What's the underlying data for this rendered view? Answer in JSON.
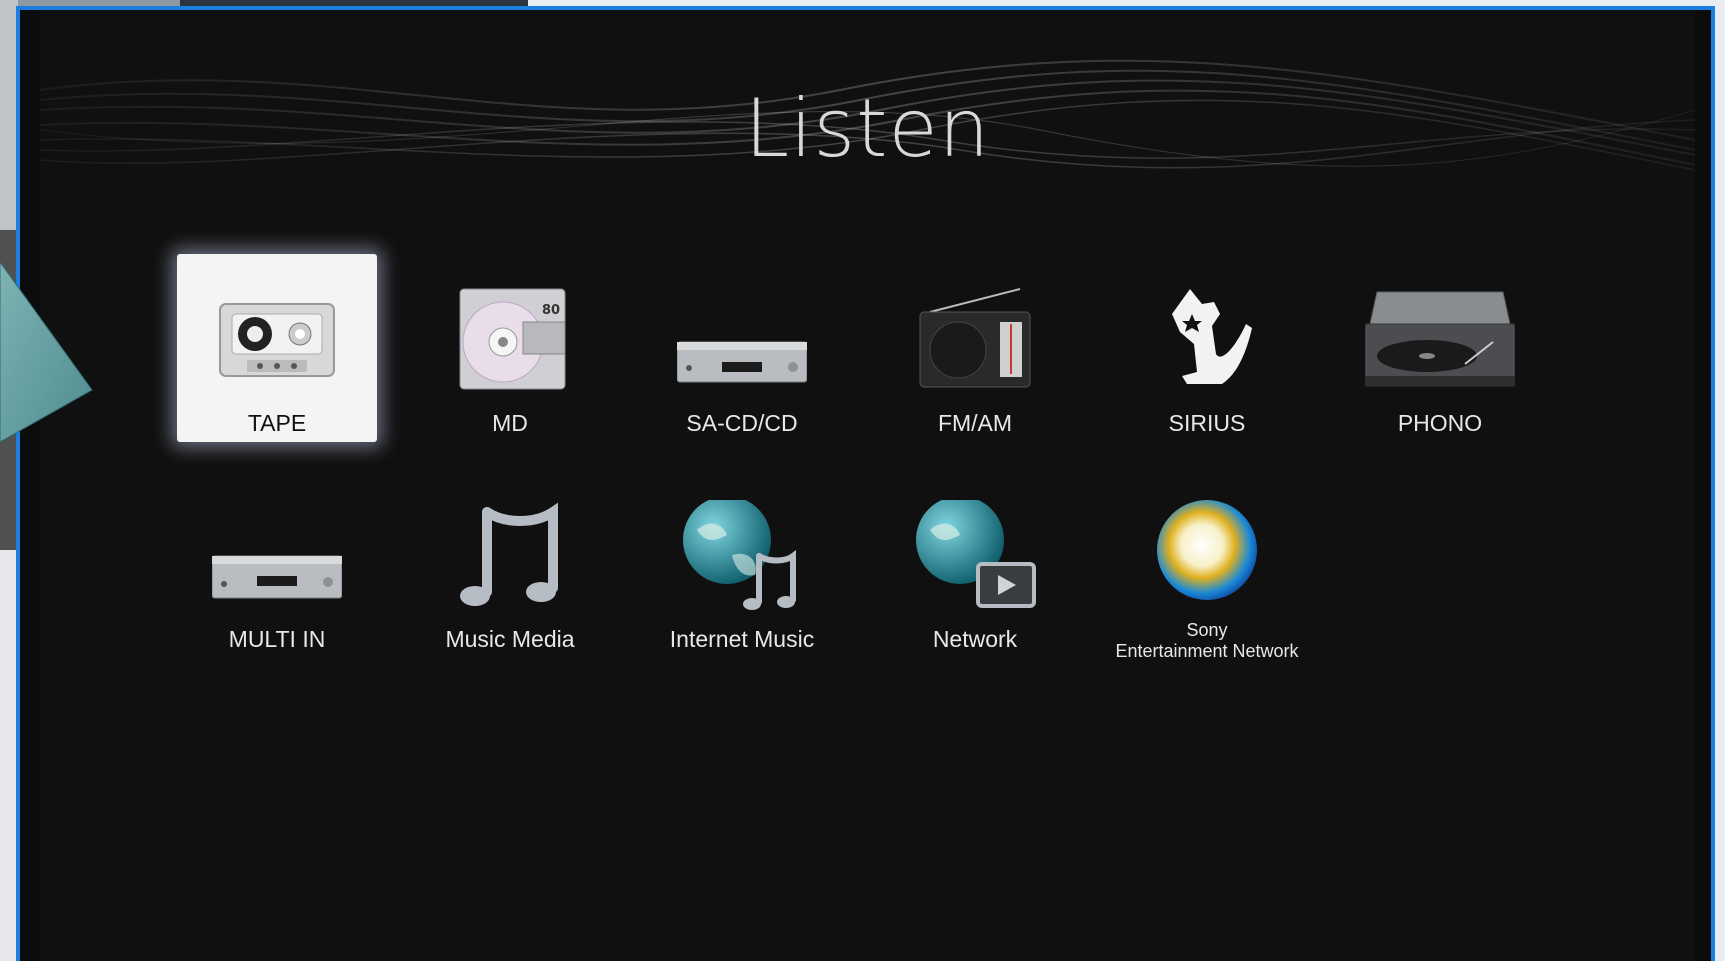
{
  "title": "Listen",
  "colors": {
    "frame_border": "#1a7fe0",
    "background": "#101010",
    "selected_bg": "#f4f4f4"
  },
  "items": [
    {
      "label": "TAPE",
      "icon": "cassette-tape-icon",
      "selected": true
    },
    {
      "label": "MD",
      "icon": "minidisc-icon",
      "badge": "80"
    },
    {
      "label": "SA-CD/CD",
      "icon": "cd-player-icon"
    },
    {
      "label": "FM/AM",
      "icon": "radio-icon"
    },
    {
      "label": "SIRIUS",
      "icon": "sirius-dog-icon"
    },
    {
      "label": "PHONO",
      "icon": "turntable-icon"
    },
    {
      "label": "MULTI IN",
      "icon": "multi-in-player-icon"
    },
    {
      "label": "Music Media",
      "icon": "music-note-icon"
    },
    {
      "label": "Internet Music",
      "icon": "globe-music-icon"
    },
    {
      "label": "Network",
      "icon": "globe-network-icon"
    },
    {
      "label_line1": "Sony",
      "label_line2": "Entertainment Network",
      "icon": "sony-entertainment-network-icon"
    }
  ]
}
